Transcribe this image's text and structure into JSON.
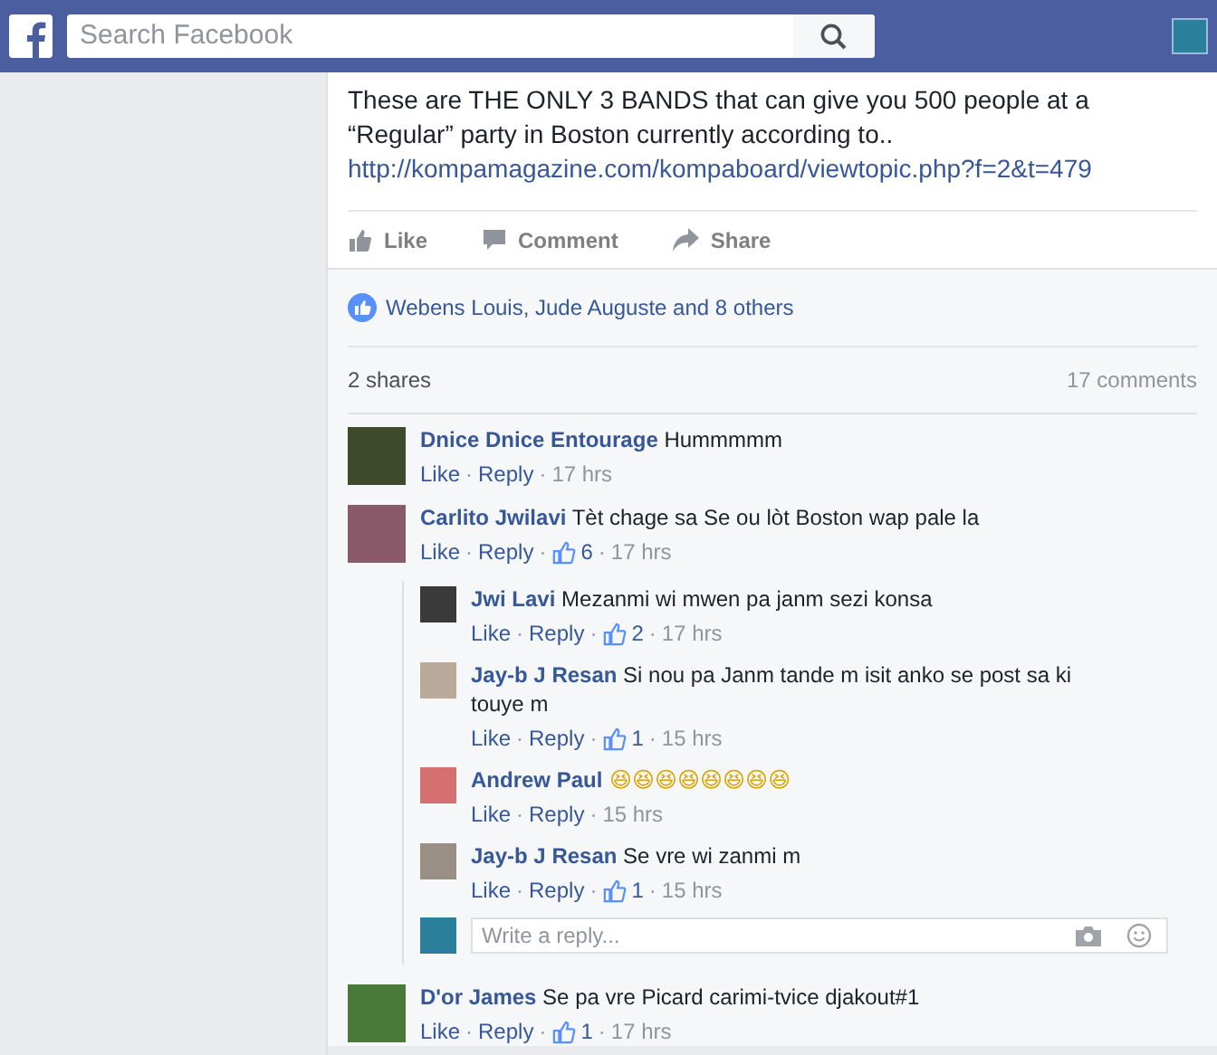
{
  "header": {
    "search": {
      "placeholder": "Search Facebook"
    }
  },
  "post": {
    "text": "These are THE ONLY 3 BANDS that can give you 500 people at a “Regular” party in Boston currently according to..",
    "link": "http://kompamagazine.com/kompaboard/viewtopic.php?f=2&t=479",
    "actions": [
      {
        "kind": "like",
        "label": "Like"
      },
      {
        "kind": "comment",
        "label": "Comment"
      },
      {
        "kind": "share",
        "label": "Share"
      }
    ]
  },
  "likes": "Webens Louis, Jude Auguste and 8 others",
  "shares": "2 shares",
  "comment_count": "17 comments",
  "comments": [
    {
      "author": "Dnice Dnice Entourage",
      "text": "Hummmmm",
      "meta": [
        {
          "kind": "link",
          "text": "Like"
        },
        {
          "kind": "dot",
          "text": "·"
        },
        {
          "kind": "link",
          "text": "Reply"
        },
        {
          "kind": "dot",
          "text": "·"
        },
        {
          "kind": "time",
          "text": "17 hrs"
        }
      ]
    },
    {
      "author": "Carlito Jwilavi",
      "text": "Tèt chage sa Se ou lòt Boston wap pale la",
      "meta": [
        {
          "kind": "link",
          "text": "Like"
        },
        {
          "kind": "dot",
          "text": "·"
        },
        {
          "kind": "link",
          "text": "Reply"
        },
        {
          "kind": "dot",
          "text": "·"
        },
        {
          "kind": "likes",
          "text": "6"
        },
        {
          "kind": "dot",
          "text": "·"
        },
        {
          "kind": "time",
          "text": "17 hrs"
        }
      ],
      "replies": [
        {
          "author": "Jwi Lavi",
          "text": "Mezanmi wi mwen pa janm sezi konsa",
          "meta": [
            {
              "kind": "link",
              "text": "Like"
            },
            {
              "kind": "dot",
              "text": "·"
            },
            {
              "kind": "link",
              "text": "Reply"
            },
            {
              "kind": "dot",
              "text": "·"
            },
            {
              "kind": "likes",
              "text": "2"
            },
            {
              "kind": "dot",
              "text": "·"
            },
            {
              "kind": "time",
              "text": "17 hrs"
            }
          ]
        },
        {
          "author": "Jay-b J Resan",
          "text": "Si nou pa Janm tande m isit anko se post sa ki touye m",
          "meta": [
            {
              "kind": "link",
              "text": "Like"
            },
            {
              "kind": "dot",
              "text": "·"
            },
            {
              "kind": "link",
              "text": "Reply"
            },
            {
              "kind": "dot",
              "text": "·"
            },
            {
              "kind": "likes",
              "text": "1"
            },
            {
              "kind": "dot",
              "text": "·"
            },
            {
              "kind": "time",
              "text": "15 hrs"
            }
          ]
        },
        {
          "author": "Andrew Paul",
          "text": "😆😆😆😆😆😆😆😆",
          "meta": [
            {
              "kind": "link",
              "text": "Like"
            },
            {
              "kind": "dot",
              "text": "·"
            },
            {
              "kind": "link",
              "text": "Reply"
            },
            {
              "kind": "dot",
              "text": "·"
            },
            {
              "kind": "time",
              "text": "15 hrs"
            }
          ]
        },
        {
          "author": "Jay-b J Resan",
          "text": "Se vre wi zanmi m",
          "meta": [
            {
              "kind": "link",
              "text": "Like"
            },
            {
              "kind": "dot",
              "text": "·"
            },
            {
              "kind": "link",
              "text": "Reply"
            },
            {
              "kind": "dot",
              "text": "·"
            },
            {
              "kind": "likes",
              "text": "1"
            },
            {
              "kind": "dot",
              "text": "·"
            },
            {
              "kind": "time",
              "text": "15 hrs"
            }
          ]
        }
      ],
      "reply_box": {
        "placeholder": "Write a reply..."
      }
    },
    {
      "author": "D'or James",
      "text": "Se pa vre Picard carimi-tvice djakout#1",
      "meta": [
        {
          "kind": "link",
          "text": "Like"
        },
        {
          "kind": "dot",
          "text": "·"
        },
        {
          "kind": "link",
          "text": "Reply"
        },
        {
          "kind": "dot",
          "text": "·"
        },
        {
          "kind": "likes",
          "text": "1"
        },
        {
          "kind": "dot",
          "text": "·"
        },
        {
          "kind": "time",
          "text": "17 hrs"
        }
      ]
    }
  ]
}
